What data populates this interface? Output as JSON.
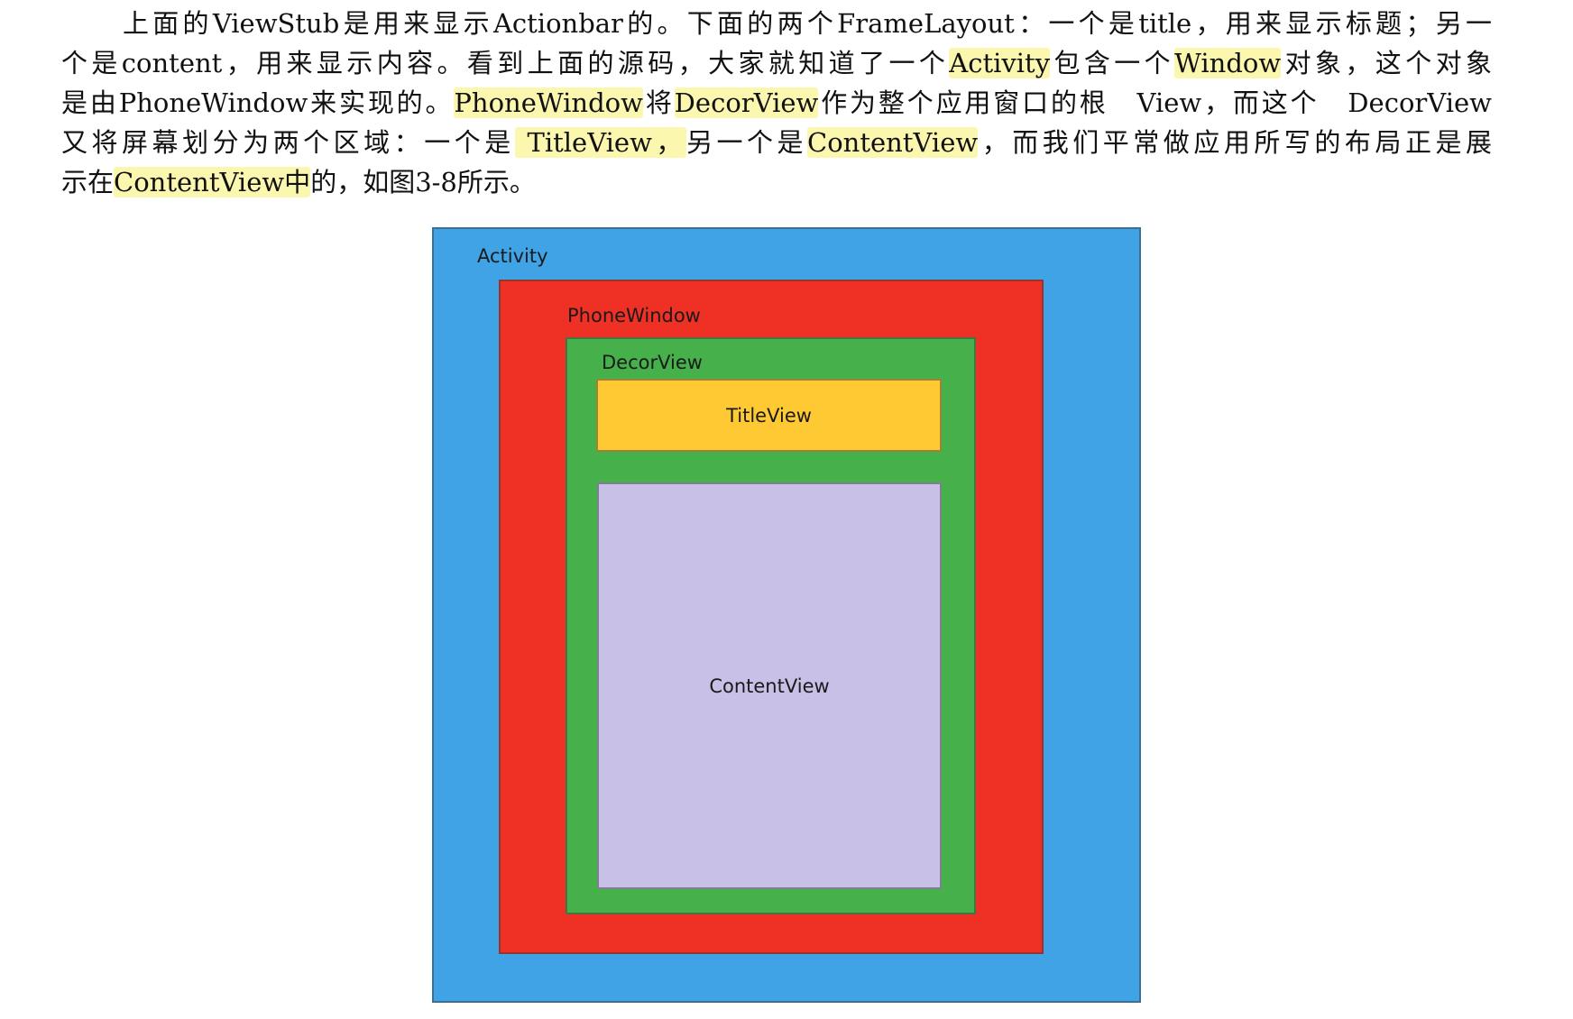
{
  "paragraph": {
    "line1_a": "上面的ViewStub是用来显示Actionbar的。下面的两个FrameLayout：一个是title，用来显示标题；另一",
    "line2_a": "个是content，用来显示内容。看到上面的源码，大家就知道了一个",
    "line2_hl1": "Activity",
    "line2_b": "包含一个",
    "line2_hl2": "Window",
    "line2_c": "对象，这个对象",
    "line3_a": "是由PhoneWindow来实现的。",
    "line3_hl1": "PhoneWindow",
    "line3_b": "将",
    "line3_hl2": "DecorView",
    "line3_c": "作为整个应用窗口的根　View，而这个　DecorView",
    "line4_a": "又将屏幕划分为两个区域：一个是",
    "line4_hl1": " TitleView，",
    "line4_b": "另一个是",
    "line4_hl2": "ContentView",
    "line4_c": "，而我们平常做应用所写的布局正是展",
    "line5_a": "示在",
    "line5_hl1": "ContentView中",
    "line5_b": "的，如图3-8所示。"
  },
  "diagram": {
    "activity_label": "Activity",
    "phonewindow_label": "PhoneWindow",
    "decorview_label": "DecorView",
    "titleview_label": "TitleView",
    "contentview_label": "ContentView",
    "colors": {
      "activity": "#3fa3e6",
      "phonewindow": "#ee3124",
      "decorview": "#46b04a",
      "titleview": "#ffc933",
      "contentview": "#c8c0e6",
      "highlight": "#f9f06e"
    }
  }
}
